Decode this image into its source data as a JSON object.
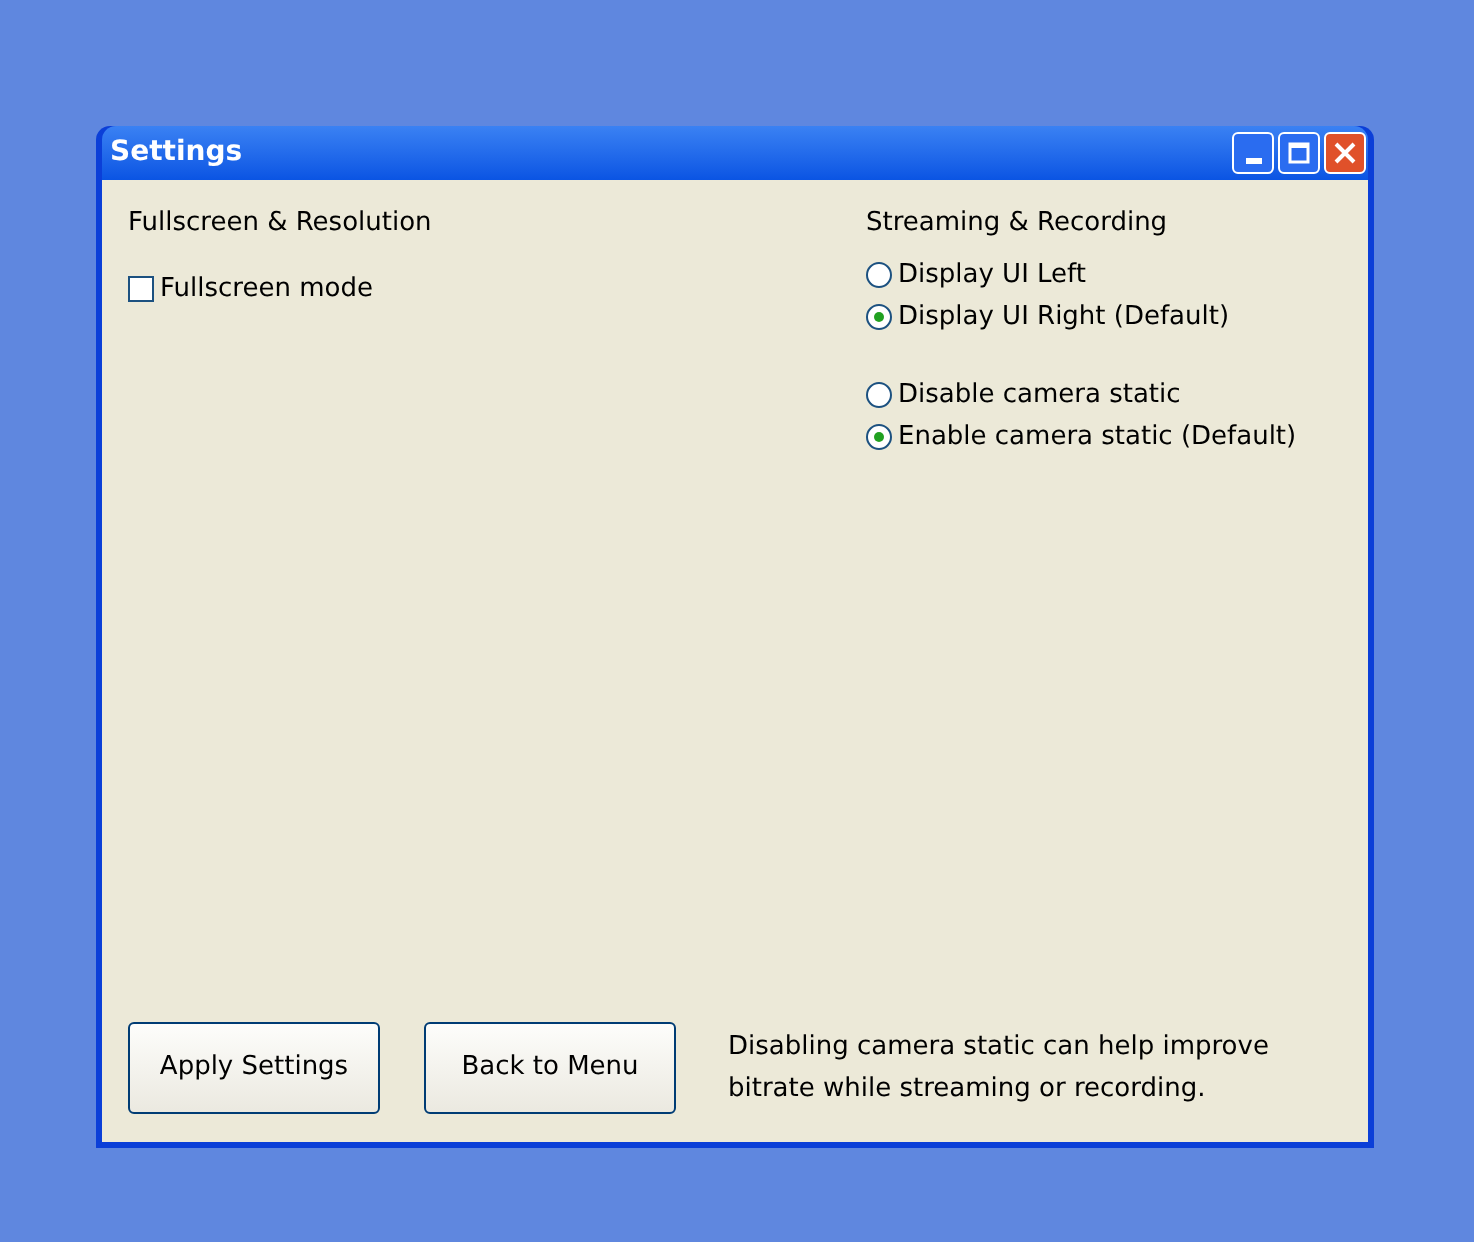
{
  "window": {
    "title": "Settings"
  },
  "left_section": {
    "heading": "Fullscreen & Resolution",
    "checkbox": {
      "label": "Fullscreen mode",
      "checked": false
    }
  },
  "right_section": {
    "heading": "Streaming & Recording",
    "radio_groups": [
      {
        "options": [
          {
            "label": "Display UI Left",
            "selected": false
          },
          {
            "label": "Display UI Right (Default)",
            "selected": true
          }
        ]
      },
      {
        "options": [
          {
            "label": "Disable camera static",
            "selected": false
          },
          {
            "label": "Enable camera static (Default)",
            "selected": true
          }
        ]
      }
    ]
  },
  "buttons": [
    "Apply Settings",
    "Back to Menu"
  ],
  "note": "Disabling camera static can help improve bitrate while streaming or recording."
}
